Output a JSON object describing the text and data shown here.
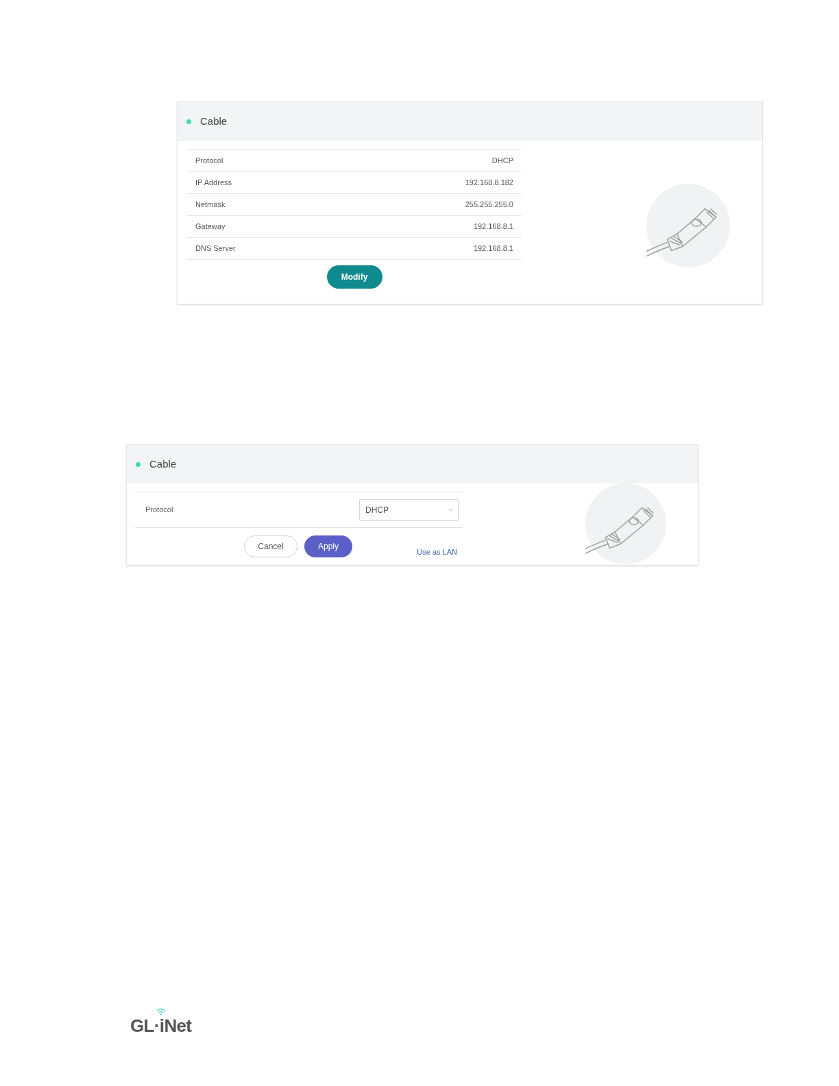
{
  "status_card": {
    "title": "Cable",
    "status_dot": {
      "color": "#3dddb2"
    },
    "rows": [
      {
        "label": "Protocol",
        "value": "DHCP"
      },
      {
        "label": "IP Address",
        "value": "192.168.8.182"
      },
      {
        "label": "Netmask",
        "value": "255.255.255.0"
      },
      {
        "label": "Gateway",
        "value": "192.168.8.1"
      },
      {
        "label": "DNS Server",
        "value": "192.168.8.1"
      }
    ],
    "button": "Modify"
  },
  "edit_card": {
    "title": "Cable",
    "status_dot": {
      "color": "#3dddb2"
    },
    "protocol_label": "Protocol",
    "protocol_value": "DHCP",
    "cancel": "Cancel",
    "apply": "Apply",
    "link": "Use as LAN"
  },
  "footer": {
    "logo": "GL·iNet"
  }
}
